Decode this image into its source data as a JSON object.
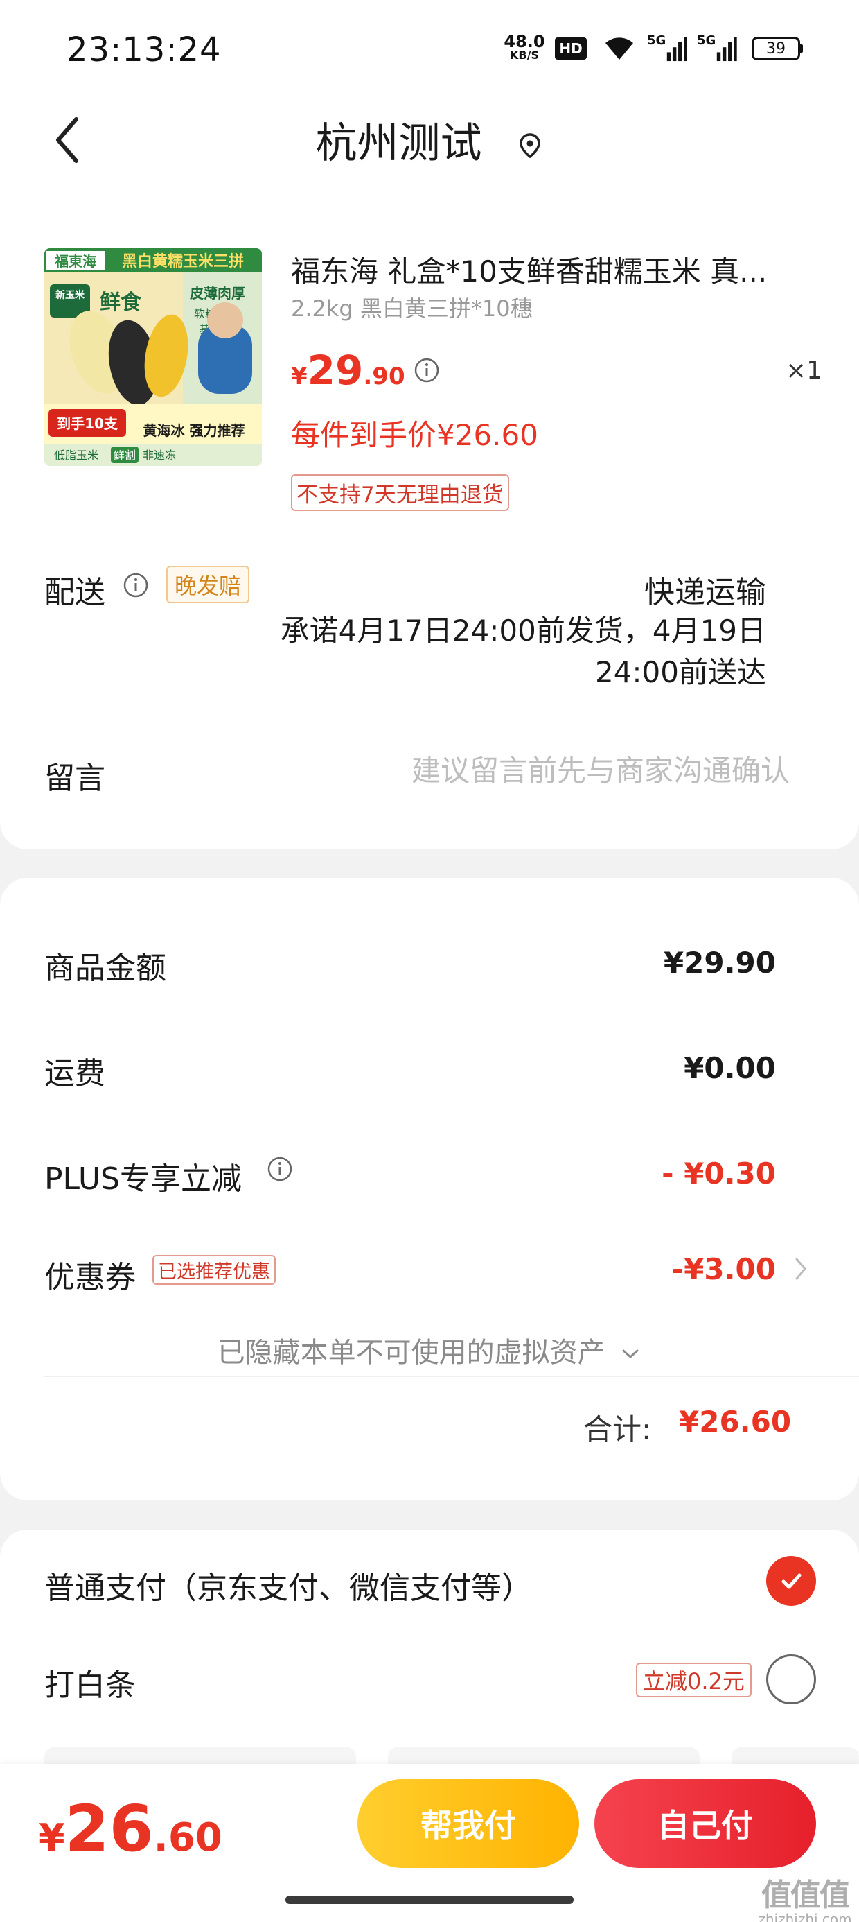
{
  "status_bar": {
    "time": "23:13:24",
    "net_speed_value": "48.0",
    "net_speed_unit": "KB/S",
    "hd_label": "HD",
    "signal_labels": [
      "5G",
      "5G"
    ],
    "battery": "39"
  },
  "nav": {
    "title": "杭州测试",
    "icons": [
      "chevron-left-icon",
      "location-pin-icon"
    ]
  },
  "product": {
    "image_texts": {
      "brand": "福東海",
      "banner": "黑白黄糯玉米三拼",
      "tag_new": "新玉米",
      "tag_fresh": "鲜食",
      "tag_thin": "皮薄肉厚",
      "tag_sweet": "软糯香甜",
      "tag_base": "基地直发",
      "count": "到手10支",
      "endorse": "黄海冰 强力推荐",
      "low_fat": "低脂玉米",
      "fresh_cut": "鲜割",
      "no_frozen": "非速冻"
    },
    "name": "福东海 礼盒*10支鲜香甜糯玉米 真...",
    "spec": "2.2kg 黑白黄三拼*10穗",
    "price_symbol": "¥",
    "price_int": "29",
    "price_dec": ".90",
    "quantity": "×1",
    "unit_price": "每件到手价¥26.60",
    "return_policy": "不支持7天无理由退货"
  },
  "delivery": {
    "label": "配送",
    "badge": "晚发赔",
    "method": "快递运输",
    "promise": "承诺4月17日24:00前发货，4月19日24:00前送达"
  },
  "message": {
    "label": "留言",
    "placeholder": "建议留言前先与商家沟通确认",
    "value": ""
  },
  "amounts": {
    "goods_label": "商品金额",
    "goods_value": "¥29.90",
    "shipping_label": "运费",
    "shipping_value": "¥0.00",
    "plus_label": "PLUS专享立减",
    "plus_value": "- ¥0.30",
    "coupon_label": "优惠券",
    "coupon_badge": "已选推荐优惠",
    "coupon_value": "-¥3.00",
    "hidden_assets": "已隐藏本单不可使用的虚拟资产",
    "total_label": "合计:",
    "total_value": "¥26.60"
  },
  "payment": {
    "normal_label": "普通支付（京东支付、微信支付等）",
    "normal_selected": true,
    "baitiao_label": "打白条",
    "baitiao_badge": "立减0.2元",
    "baitiao_selected": false
  },
  "footer": {
    "price_symbol": "¥",
    "price_int": "26",
    "price_dec": ".60",
    "help_pay": "帮我付",
    "self_pay": "自己付"
  },
  "watermark": {
    "logo": "值值值",
    "url": "zhizhizhi.com"
  },
  "colors": {
    "accent_red": "#e93323",
    "help_yellow": "#ffb300",
    "badge_orange": "#d4851a"
  }
}
